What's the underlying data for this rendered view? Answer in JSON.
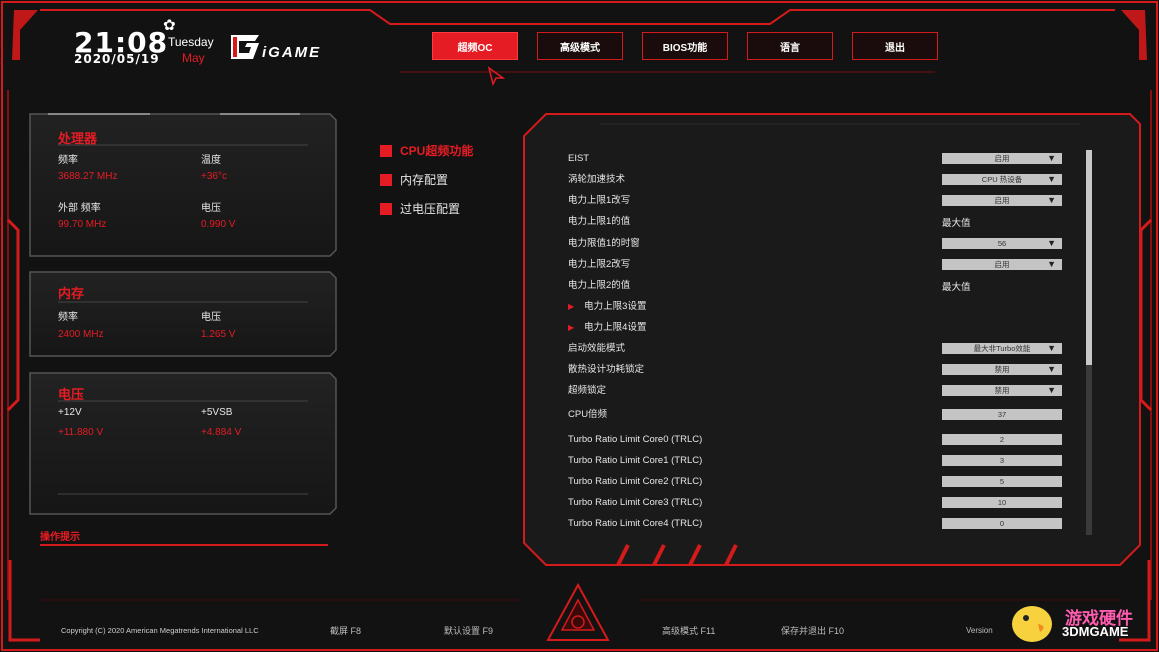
{
  "header": {
    "time": "21:08",
    "date": "2020/05/19",
    "weekday": "Tuesday",
    "month": "May",
    "brand": "iGAME"
  },
  "tabs": [
    {
      "label": "超频OC",
      "active": true
    },
    {
      "label": "高级模式",
      "active": false
    },
    {
      "label": "BIOS功能",
      "active": false
    },
    {
      "label": "语言",
      "active": false
    },
    {
      "label": "退出",
      "active": false
    }
  ],
  "cpu_panel": {
    "title": "处理器",
    "freq_label": "频率",
    "freq_value": "3688.27 MHz",
    "temp_label": "温度",
    "temp_value": "+36°c",
    "ext_freq_label": "外部 频率",
    "ext_freq_value": "99.70 MHz",
    "volt_label": "电压",
    "volt_value": "0.990 V"
  },
  "mem_panel": {
    "title": "内存",
    "freq_label": "频率",
    "freq_value": "2400 MHz",
    "volt_label": "电压",
    "volt_value": "1.265 V"
  },
  "volt_panel": {
    "title": "电压",
    "v12_label": "+12V",
    "v12_value": "+11.880 V",
    "v5_label": "+5VSB",
    "v5_value": "+4.884 V"
  },
  "hint": "操作提示",
  "menu": [
    {
      "label": "CPU超频功能",
      "active": true
    },
    {
      "label": "内存配置",
      "active": false
    },
    {
      "label": "过电压配置",
      "active": false
    }
  ],
  "settings": [
    {
      "label": "EIST",
      "type": "select",
      "value": "启用"
    },
    {
      "label": "涡轮加速技术",
      "type": "select",
      "value": "CPU 热设备"
    },
    {
      "label": "电力上限1改写",
      "type": "select",
      "value": "启用"
    },
    {
      "label": "电力上限1的值",
      "type": "text",
      "value": "最大值"
    },
    {
      "label": "电力限值1的时窗",
      "type": "select",
      "value": "56"
    },
    {
      "label": "电力上限2改写",
      "type": "select",
      "value": "启用"
    },
    {
      "label": "电力上限2的值",
      "type": "text",
      "value": "最大值"
    },
    {
      "label": "电力上限3设置",
      "type": "submenu",
      "value": ""
    },
    {
      "label": "电力上限4设置",
      "type": "submenu",
      "value": ""
    },
    {
      "label": "启动效能模式",
      "type": "select",
      "value": "最大非Turbo效能"
    },
    {
      "label": "散热设计功耗锁定",
      "type": "select",
      "value": "禁用"
    },
    {
      "label": "超频锁定",
      "type": "select",
      "value": "禁用"
    },
    {
      "label": "CPU倍频",
      "type": "input",
      "value": "37"
    },
    {
      "label": "Turbo Ratio Limit Core0 (TRLC)",
      "type": "input",
      "value": "2"
    },
    {
      "label": "Turbo Ratio Limit Core1 (TRLC)",
      "type": "input",
      "value": "3"
    },
    {
      "label": "Turbo Ratio Limit Core2 (TRLC)",
      "type": "input",
      "value": "5"
    },
    {
      "label": "Turbo Ratio Limit Core3 (TRLC)",
      "type": "input",
      "value": "10"
    },
    {
      "label": "Turbo Ratio Limit Core4 (TRLC)",
      "type": "input",
      "value": "0"
    }
  ],
  "footer": {
    "copyright": "Copyright (C) 2020 American Megatrends International LLC",
    "screenshot": "截屏 F8",
    "defaults": "默认设置 F9",
    "advanced": "高级模式 F11",
    "save_exit": "保存并退出 F10",
    "version": "Version"
  },
  "watermark": {
    "cn": "游戏硬件",
    "en": "3DMGAME"
  },
  "colors": {
    "accent": "#e51c23",
    "background": "#121212",
    "control": "#c4c4c4"
  }
}
